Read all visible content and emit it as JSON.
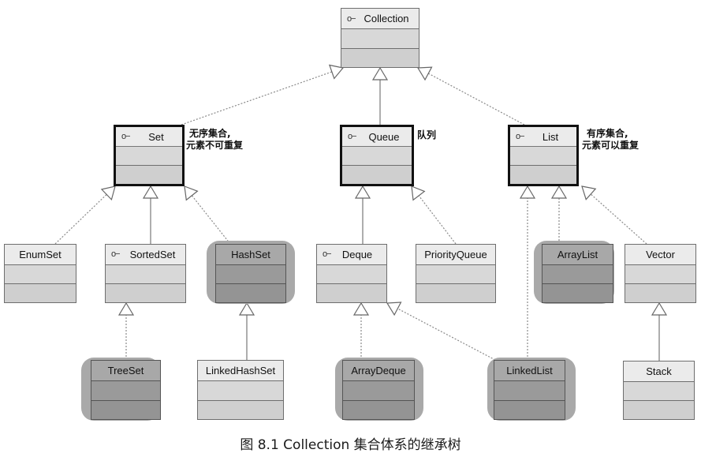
{
  "diagram": {
    "title": "Collection class inheritance tree",
    "nodes": [
      {
        "id": "Collection",
        "label": "Collection",
        "kind": "interface",
        "style": "plain"
      },
      {
        "id": "Set",
        "label": "Set",
        "kind": "interface",
        "style": "bold"
      },
      {
        "id": "Queue",
        "label": "Queue",
        "kind": "interface",
        "style": "bold"
      },
      {
        "id": "List",
        "label": "List",
        "kind": "interface",
        "style": "bold"
      },
      {
        "id": "EnumSet",
        "label": "EnumSet",
        "kind": "class",
        "style": "plain"
      },
      {
        "id": "SortedSet",
        "label": "SortedSet",
        "kind": "interface",
        "style": "plain"
      },
      {
        "id": "HashSet",
        "label": "HashSet",
        "kind": "class",
        "style": "highlighted"
      },
      {
        "id": "Deque",
        "label": "Deque",
        "kind": "interface",
        "style": "plain"
      },
      {
        "id": "PriorityQueue",
        "label": "PriorityQueue",
        "kind": "class",
        "style": "plain"
      },
      {
        "id": "ArrayList",
        "label": "ArrayList",
        "kind": "class",
        "style": "highlighted"
      },
      {
        "id": "Vector",
        "label": "Vector",
        "kind": "class",
        "style": "plain"
      },
      {
        "id": "TreeSet",
        "label": "TreeSet",
        "kind": "class",
        "style": "highlighted"
      },
      {
        "id": "LinkedHashSet",
        "label": "LinkedHashSet",
        "kind": "class",
        "style": "plain"
      },
      {
        "id": "ArrayDeque",
        "label": "ArrayDeque",
        "kind": "class",
        "style": "highlighted"
      },
      {
        "id": "LinkedList",
        "label": "LinkedList",
        "kind": "class",
        "style": "highlighted"
      },
      {
        "id": "Stack",
        "label": "Stack",
        "kind": "class",
        "style": "plain"
      }
    ],
    "edges": [
      {
        "from": "Set",
        "to": "Collection",
        "type": "realization"
      },
      {
        "from": "Queue",
        "to": "Collection",
        "type": "generalization"
      },
      {
        "from": "List",
        "to": "Collection",
        "type": "realization"
      },
      {
        "from": "EnumSet",
        "to": "Set",
        "type": "realization"
      },
      {
        "from": "SortedSet",
        "to": "Set",
        "type": "generalization"
      },
      {
        "from": "HashSet",
        "to": "Set",
        "type": "realization"
      },
      {
        "from": "Deque",
        "to": "Queue",
        "type": "generalization"
      },
      {
        "from": "PriorityQueue",
        "to": "Queue",
        "type": "realization"
      },
      {
        "from": "LinkedList",
        "to": "List",
        "type": "realization"
      },
      {
        "from": "ArrayList",
        "to": "List",
        "type": "realization"
      },
      {
        "from": "Vector",
        "to": "List",
        "type": "realization"
      },
      {
        "from": "TreeSet",
        "to": "SortedSet",
        "type": "realization"
      },
      {
        "from": "LinkedHashSet",
        "to": "HashSet",
        "type": "generalization"
      },
      {
        "from": "ArrayDeque",
        "to": "Deque",
        "type": "realization"
      },
      {
        "from": "LinkedList",
        "to": "Deque",
        "type": "realization"
      },
      {
        "from": "Stack",
        "to": "Vector",
        "type": "generalization"
      }
    ],
    "notes": {
      "set": [
        "无序集合,",
        "元素不可重复"
      ],
      "queue": [
        "队列"
      ],
      "list": [
        "有序集合,",
        "元素可以重复"
      ]
    },
    "interface_icon": "interface-lollipop-icon",
    "interface_icon_glyph": "o−"
  },
  "caption": "图 8.1    Collection 集合体系的继承树"
}
